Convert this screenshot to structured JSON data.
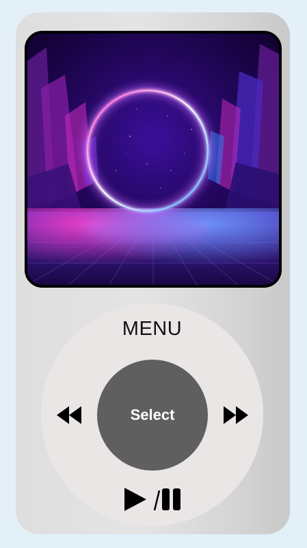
{
  "device": {
    "screen_image": "neon-ring-portal-artwork",
    "wheel": {
      "menu_label": "MENU",
      "select_label": "Select",
      "prev_icon": "rewind-icon",
      "next_icon": "fast-forward-icon",
      "play_pause_icon": "play-pause-icon"
    }
  },
  "colors": {
    "page_background": "#e3f0f8",
    "device_body": "#dedede",
    "wheel": "#ebe6e6",
    "select_button": "#5f5f5f",
    "neon_ring": "#b060ff"
  }
}
